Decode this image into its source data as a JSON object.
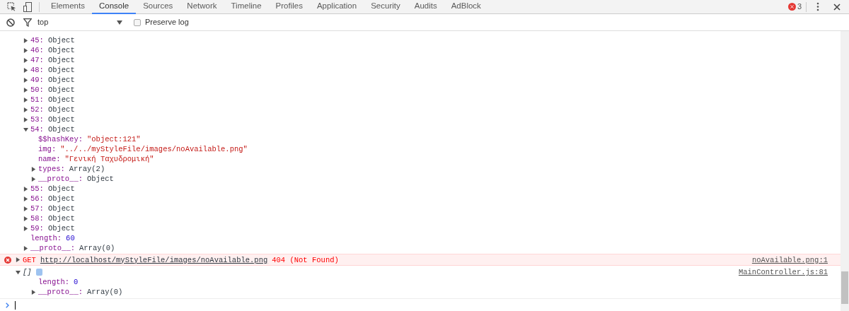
{
  "tabs": [
    {
      "label": "Elements",
      "selected": false
    },
    {
      "label": "Console",
      "selected": true
    },
    {
      "label": "Sources",
      "selected": false
    },
    {
      "label": "Network",
      "selected": false
    },
    {
      "label": "Timeline",
      "selected": false
    },
    {
      "label": "Profiles",
      "selected": false
    },
    {
      "label": "Application",
      "selected": false
    },
    {
      "label": "Security",
      "selected": false
    },
    {
      "label": "Audits",
      "selected": false
    },
    {
      "label": "AdBlock",
      "selected": false
    }
  ],
  "error_count": "3",
  "toolbar": {
    "context": "top",
    "preserve_log": {
      "label": "Preserve log",
      "checked": false
    }
  },
  "log": [
    {
      "kind": "tree",
      "nodes": [
        {
          "key": "45:",
          "value": "Object",
          "kind": "object",
          "expanded": false
        },
        {
          "key": "46:",
          "value": "Object",
          "kind": "object",
          "expanded": false
        },
        {
          "key": "47:",
          "value": "Object",
          "kind": "object",
          "expanded": false
        },
        {
          "key": "48:",
          "value": "Object",
          "kind": "object",
          "expanded": false
        },
        {
          "key": "49:",
          "value": "Object",
          "kind": "object",
          "expanded": false
        },
        {
          "key": "50:",
          "value": "Object",
          "kind": "object",
          "expanded": false
        },
        {
          "key": "51:",
          "value": "Object",
          "kind": "object",
          "expanded": false
        },
        {
          "key": "52:",
          "value": "Object",
          "kind": "object",
          "expanded": false
        },
        {
          "key": "53:",
          "value": "Object",
          "kind": "object",
          "expanded": false
        },
        {
          "key": "54:",
          "value": "Object",
          "kind": "object",
          "expanded": true,
          "children": [
            {
              "key": "$$hashKey:",
              "value": "\"object:121\"",
              "kind": "string"
            },
            {
              "key": "img:",
              "value": "\"../../myStyleFile/images/noAvailable.png\"",
              "kind": "string"
            },
            {
              "key": "name:",
              "value": "\"Γενική Ταχυδρομική\"",
              "kind": "string"
            },
            {
              "key": "types:",
              "value": "Array(2)",
              "kind": "object",
              "expanded": false
            },
            {
              "key": "__proto__:",
              "value": "Object",
              "kind": "object",
              "expanded": false
            }
          ]
        },
        {
          "key": "55:",
          "value": "Object",
          "kind": "object",
          "expanded": false
        },
        {
          "key": "56:",
          "value": "Object",
          "kind": "object",
          "expanded": false
        },
        {
          "key": "57:",
          "value": "Object",
          "kind": "object",
          "expanded": false
        },
        {
          "key": "58:",
          "value": "Object",
          "kind": "object",
          "expanded": false
        },
        {
          "key": "59:",
          "value": "Object",
          "kind": "object",
          "expanded": false
        },
        {
          "key": "length:",
          "value": "60",
          "kind": "number"
        },
        {
          "key": "__proto__:",
          "value": "Array(0)",
          "kind": "object",
          "expanded": false
        }
      ]
    },
    {
      "kind": "error",
      "expanded": false,
      "method": "GET",
      "url": "http://localhost/myStyleFile/images/noAvailable.png",
      "status": "404 (Not Found)",
      "source": "noAvailable.png:1"
    },
    {
      "kind": "array",
      "expanded": true,
      "summary": "[]",
      "source": "MainController.js:81",
      "nodes": [
        {
          "key": "length:",
          "value": "0",
          "kind": "number"
        },
        {
          "key": "__proto__:",
          "value": "Array(0)",
          "kind": "object",
          "expanded": false
        }
      ]
    }
  ]
}
